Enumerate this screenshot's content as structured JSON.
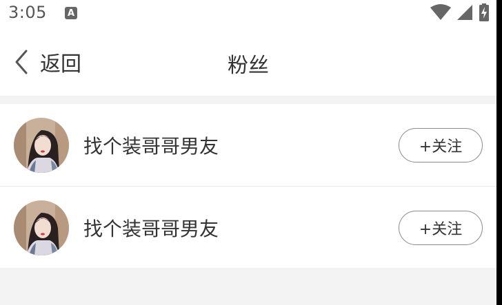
{
  "status_bar": {
    "time": "3:05",
    "notification_icon": "A",
    "icons": [
      "wifi-icon",
      "cell-signal-icon",
      "battery-charging-icon"
    ]
  },
  "nav": {
    "back_label": "返回",
    "title": "粉丝"
  },
  "followers": [
    {
      "name": "找个装哥哥男友",
      "follow_label": "+关注",
      "avatar": "avatar-photo"
    },
    {
      "name": "找个装哥哥男友",
      "follow_label": "+关注",
      "avatar": "avatar-photo"
    }
  ],
  "colors": {
    "background": "#f3f3f3",
    "surface": "#ffffff",
    "text": "#333333",
    "button_border": "#8a8a8a"
  }
}
